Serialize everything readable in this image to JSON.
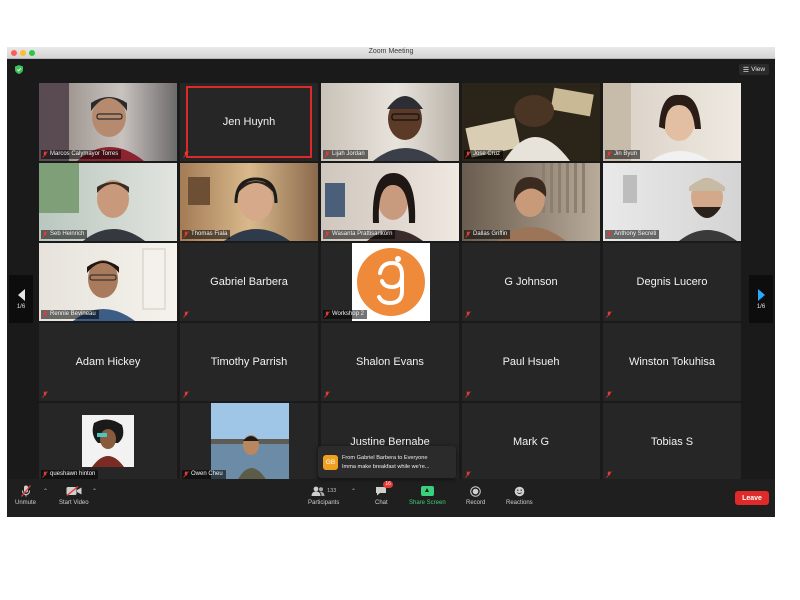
{
  "window": {
    "title": "Zoom Meeting"
  },
  "header": {
    "view_label": "View"
  },
  "pagination": {
    "left": "1/6",
    "right": "1/6"
  },
  "tiles": [
    {
      "name": "Marcos Calymayor Torres",
      "type": "video"
    },
    {
      "name": "Jen Huynh",
      "type": "name-highlight"
    },
    {
      "name": "Lijah Jordan",
      "type": "video"
    },
    {
      "name": "Jose Cruz",
      "type": "video",
      "active_speaker": true
    },
    {
      "name": "Jin Byun",
      "type": "video"
    },
    {
      "name": "Seb Heinrich",
      "type": "video"
    },
    {
      "name": "Thomas Fiala",
      "type": "video"
    },
    {
      "name": "Wasanta Prattisarikorn",
      "type": "video"
    },
    {
      "name": "Dallas Griffin",
      "type": "video"
    },
    {
      "name": "Anthony Secreti",
      "type": "video"
    },
    {
      "name": "Rennie Bevineau",
      "type": "video"
    },
    {
      "name": "Gabriel Barbera",
      "type": "name"
    },
    {
      "name": "Workshop 2",
      "type": "logo"
    },
    {
      "name": "G Johnson",
      "type": "name"
    },
    {
      "name": "Degnis Lucero",
      "type": "name"
    },
    {
      "name": "Adam Hickey",
      "type": "name"
    },
    {
      "name": "Timothy Parrish",
      "type": "name"
    },
    {
      "name": "Shalon Evans",
      "type": "name"
    },
    {
      "name": "Paul Hsueh",
      "type": "name"
    },
    {
      "name": "Winston Tokuhisa",
      "type": "name"
    },
    {
      "name": "queshawn hinton",
      "type": "photo"
    },
    {
      "name": "Owen Cheu",
      "type": "photo"
    },
    {
      "name": "Justine Bernabe",
      "type": "name"
    },
    {
      "name": "Mark G",
      "type": "name"
    },
    {
      "name": "Tobias S",
      "type": "name"
    }
  ],
  "chat_notification": {
    "avatar_initials": "GB",
    "header": "From Gabriel Barbera to Everyone",
    "message": "Imma make breakfast while we're..."
  },
  "toolbar": {
    "unmute": "Unmute",
    "start_video": "Start Video",
    "participants": "Participants",
    "participants_count": "133",
    "chat": "Chat",
    "chat_badge": "16",
    "share_screen": "Share Screen",
    "record": "Record",
    "reactions": "Reactions",
    "leave": "Leave"
  },
  "colors": {
    "active_speaker": "#d2e47a",
    "highlight_border": "#e02828",
    "share_green": "#3ad17c",
    "leave_red": "#e02a2a",
    "workshop_orange": "#ef8a3b"
  }
}
